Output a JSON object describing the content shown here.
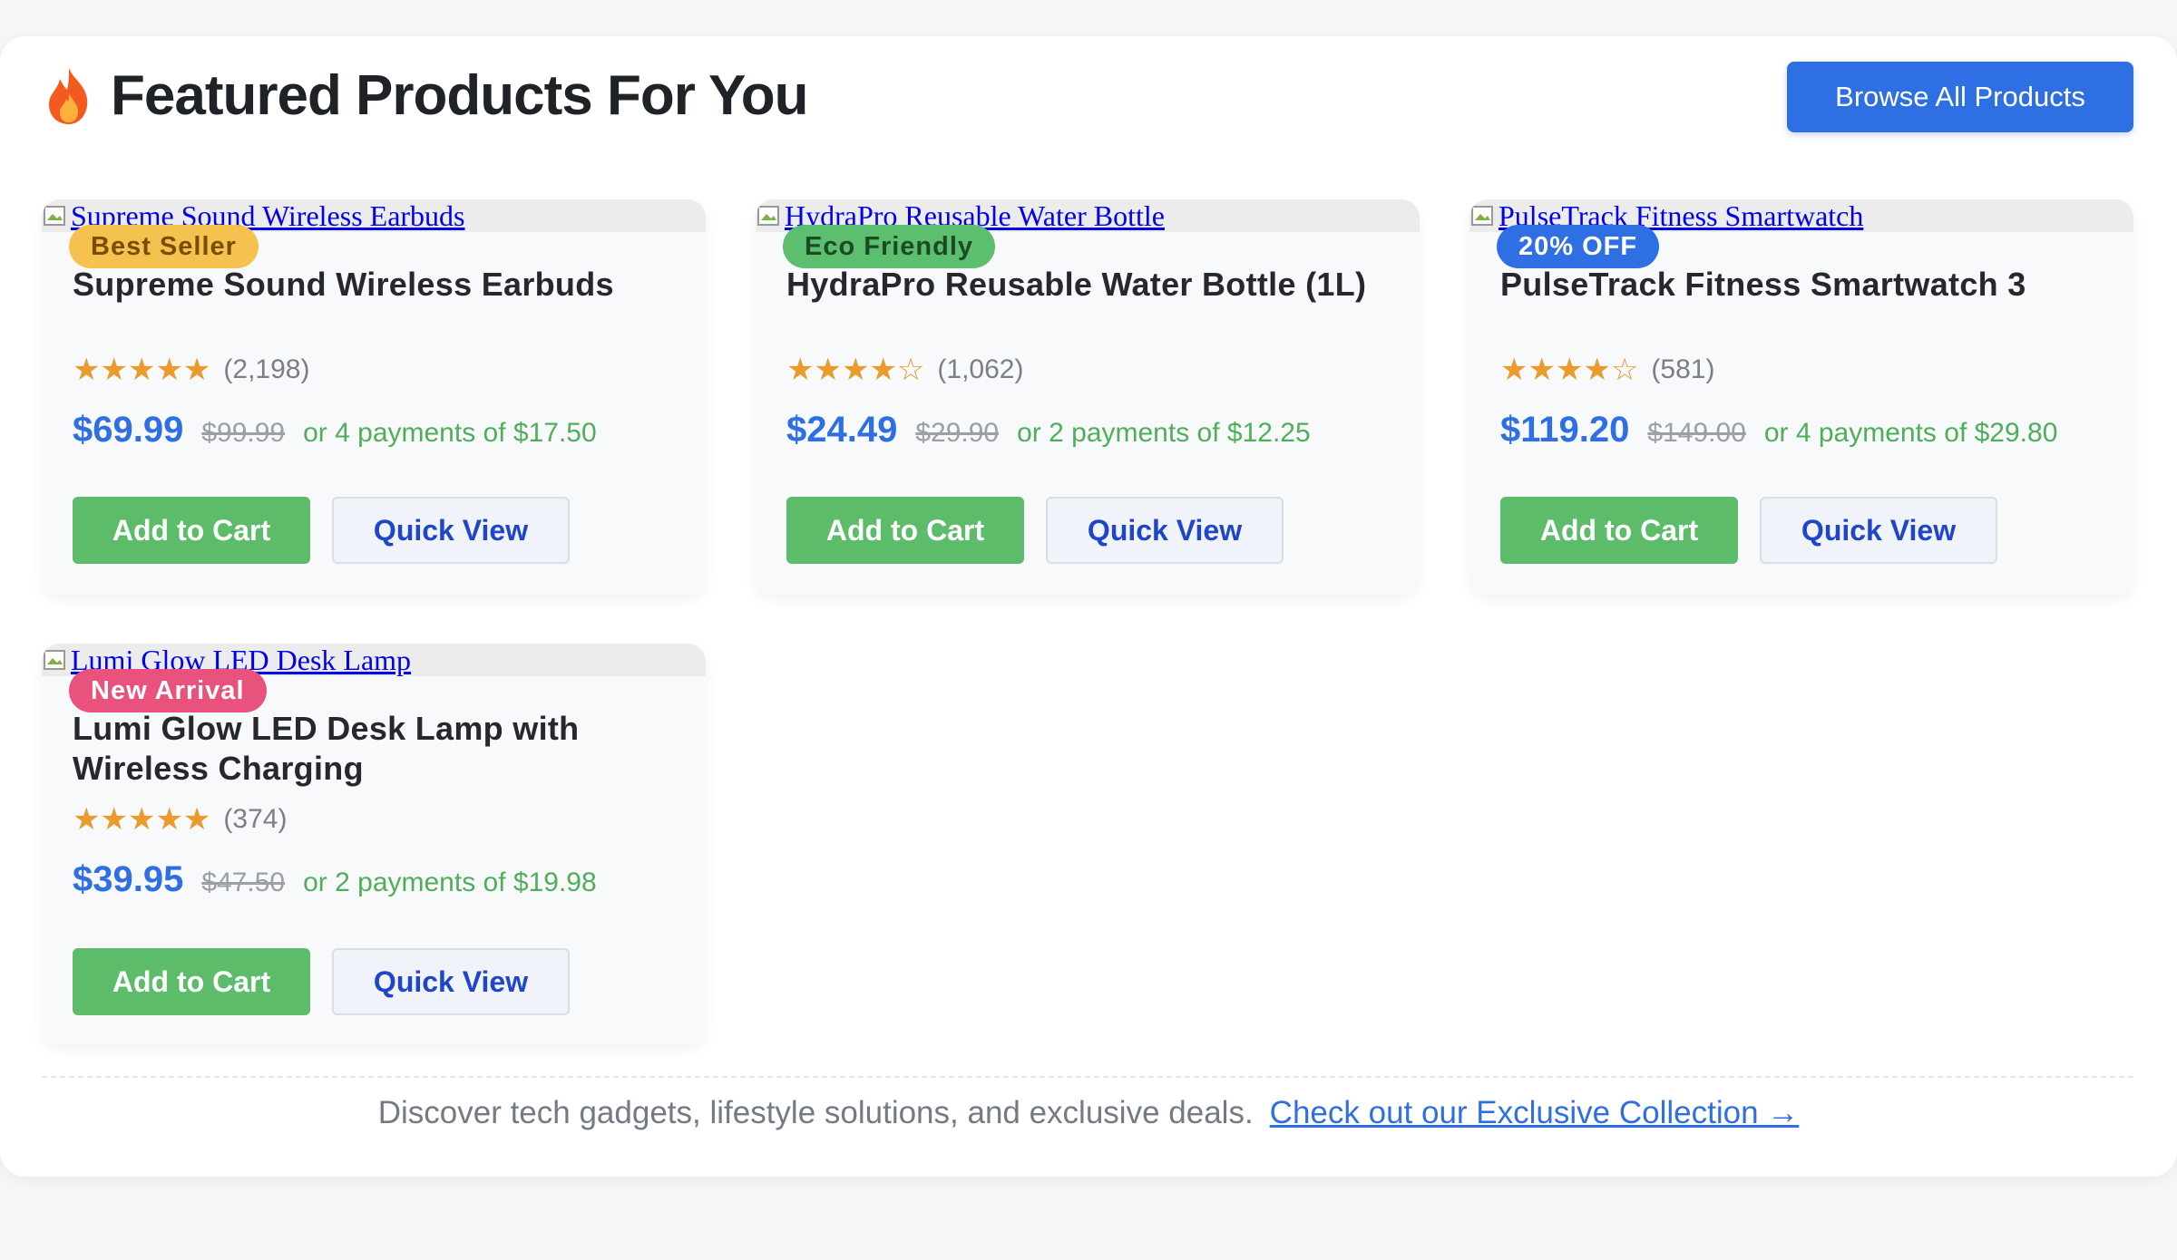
{
  "header": {
    "title": "Featured Products For You",
    "title_icon": "fire-icon",
    "browse_label": "Browse All Products"
  },
  "products": [
    {
      "image_alt": "Supreme Sound Wireless Earbuds",
      "badge": "Best Seller",
      "badge_color": "#f5c24f",
      "name": "Supreme Sound Wireless Earbuds",
      "stars": "★★★★★",
      "rating": 5,
      "reviews": "(2,198)",
      "price": "$69.99",
      "old_price": "$99.99",
      "installments": "or 4 payments of $17.50",
      "add_label": "Add to Cart",
      "quick_label": "Quick View"
    },
    {
      "image_alt": "HydraPro Reusable Water Bottle",
      "badge": "Eco Friendly",
      "badge_color": "#5cbf70",
      "name": "HydraPro Reusable Water Bottle (1L)",
      "stars": "★★★★☆",
      "rating": 4,
      "reviews": "(1,062)",
      "price": "$24.49",
      "old_price": "$29.90",
      "installments": "or 2 payments of $12.25",
      "add_label": "Add to Cart",
      "quick_label": "Quick View"
    },
    {
      "image_alt": "PulseTrack Fitness Smartwatch",
      "badge": "20% OFF",
      "badge_color": "#2f6fe4",
      "name": "PulseTrack Fitness Smartwatch 3",
      "stars": "★★★★☆",
      "rating": 4,
      "reviews": "(581)",
      "price": "$119.20",
      "old_price": "$149.00",
      "installments": "or 4 payments of $29.80",
      "add_label": "Add to Cart",
      "quick_label": "Quick View"
    },
    {
      "image_alt": "Lumi Glow LED Desk Lamp",
      "badge": "New Arrival",
      "badge_color": "#e8527c",
      "name": "Lumi Glow LED Desk Lamp with Wireless Charging",
      "stars": "★★★★★",
      "rating": 5,
      "reviews": "(374)",
      "price": "$39.95",
      "old_price": "$47.50",
      "installments": "or 2 payments of $19.98",
      "add_label": "Add to Cart",
      "quick_label": "Quick View"
    }
  ],
  "footer": {
    "text": "Discover tech gadgets, lifestyle solutions, and exclusive deals.",
    "link_label": "Check out our Exclusive Collection →"
  },
  "colors": {
    "accent": "#2f6fe4",
    "add_to_cart": "#5cbc69",
    "star": "#eb9a2e"
  }
}
